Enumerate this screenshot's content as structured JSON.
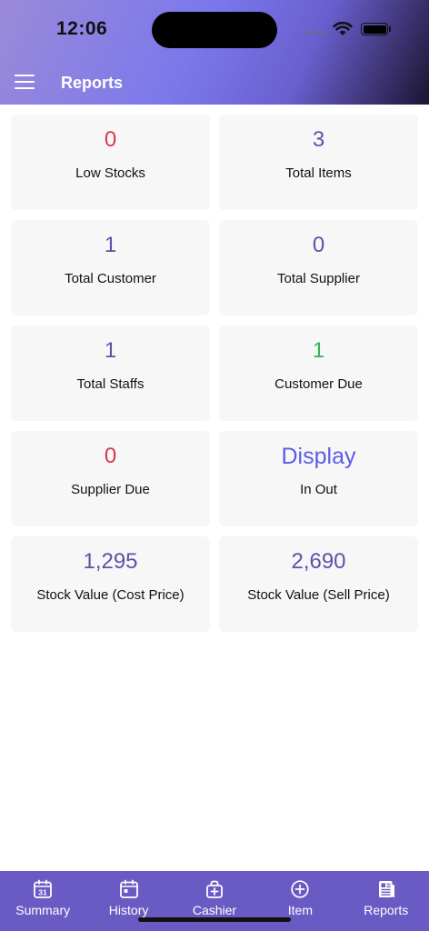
{
  "status": {
    "time": "12:06"
  },
  "header": {
    "title": "Reports"
  },
  "cards": [
    {
      "value": "0",
      "label": "Low Stocks",
      "color": "#d63a4a"
    },
    {
      "value": "3",
      "label": "Total Items",
      "color": "#5b53a6"
    },
    {
      "value": "1",
      "label": "Total Customer",
      "color": "#5b53a6"
    },
    {
      "value": "0",
      "label": "Total Supplier",
      "color": "#5b53a6"
    },
    {
      "value": "1",
      "label": "Total Staffs",
      "color": "#5b53a6"
    },
    {
      "value": "1",
      "label": "Customer Due",
      "color": "#36b05a"
    },
    {
      "value": "0",
      "label": "Supplier Due",
      "color": "#d63a4a"
    },
    {
      "value": "Display",
      "label": "In Out",
      "color": "#5a5ce6"
    },
    {
      "value": "1,295",
      "label": "Stock Value (Cost Price)",
      "color": "#5b53a6"
    },
    {
      "value": "2,690",
      "label": "Stock Value (Sell Price)",
      "color": "#5b53a6"
    }
  ],
  "tabbar": {
    "color": "#6a5bc4",
    "items": [
      {
        "label": "Summary",
        "icon": "calendar-icon"
      },
      {
        "label": "History",
        "icon": "history-calendar-icon"
      },
      {
        "label": "Cashier",
        "icon": "cash-bag-icon"
      },
      {
        "label": "Item",
        "icon": "add-circle-icon"
      },
      {
        "label": "Reports",
        "icon": "reports-icon"
      }
    ]
  }
}
